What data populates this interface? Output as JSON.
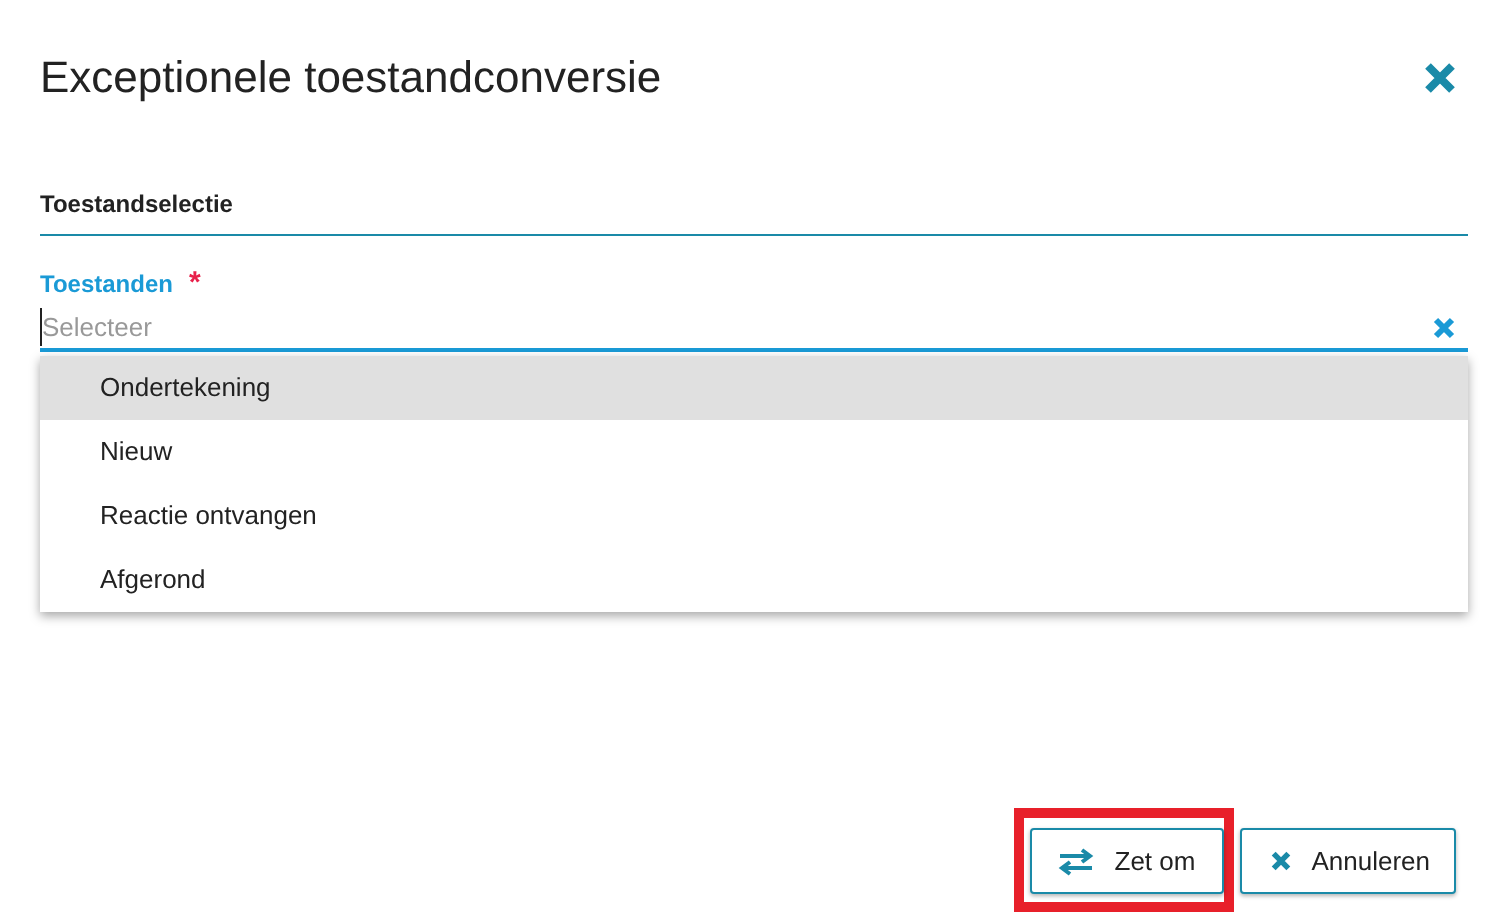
{
  "dialog": {
    "title": "Exceptionele toestandconversie"
  },
  "section": {
    "title": "Toestandselectie"
  },
  "field": {
    "label": "Toestanden",
    "required_mark": "*",
    "placeholder": "Selecteer"
  },
  "options": [
    {
      "label": "Ondertekening",
      "selected": true
    },
    {
      "label": "Nieuw",
      "selected": false
    },
    {
      "label": "Reactie ontvangen",
      "selected": false
    },
    {
      "label": "Afgerond",
      "selected": false
    }
  ],
  "buttons": [
    {
      "label": "Zet om",
      "kind": "convert",
      "highlighted": true
    },
    {
      "label": "Annuleren",
      "kind": "cancel",
      "highlighted": false
    }
  ]
}
